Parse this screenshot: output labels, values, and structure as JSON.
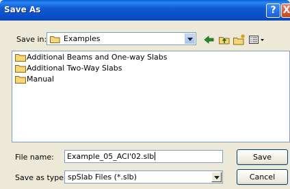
{
  "window": {
    "title": "Save As"
  },
  "titlebar_buttons": {
    "help": "?",
    "close": "X"
  },
  "save_in": {
    "label": "Save in:",
    "value": "Examples"
  },
  "toolbar": {
    "icons": [
      "back-icon",
      "up-folder-icon",
      "new-folder-icon",
      "views-menu-icon"
    ]
  },
  "files": [
    {
      "name": "Additional Beams and One-way Slabs",
      "icon": "folder-icon"
    },
    {
      "name": "Additional Two-Way Slabs",
      "icon": "folder-icon"
    },
    {
      "name": "Manual",
      "icon": "folder-icon"
    }
  ],
  "file_name": {
    "label": "File name:",
    "value": "Example_05_ACI'02.slb"
  },
  "save_as_type": {
    "label": "Save as type:",
    "value": "spSlab Files (*.slb)"
  },
  "buttons": {
    "save": "Save",
    "cancel": "Cancel"
  },
  "colors": {
    "titlebar": "#0a4fc8",
    "dialog_bg": "#ece9d8",
    "field_border": "#7f9db9"
  }
}
